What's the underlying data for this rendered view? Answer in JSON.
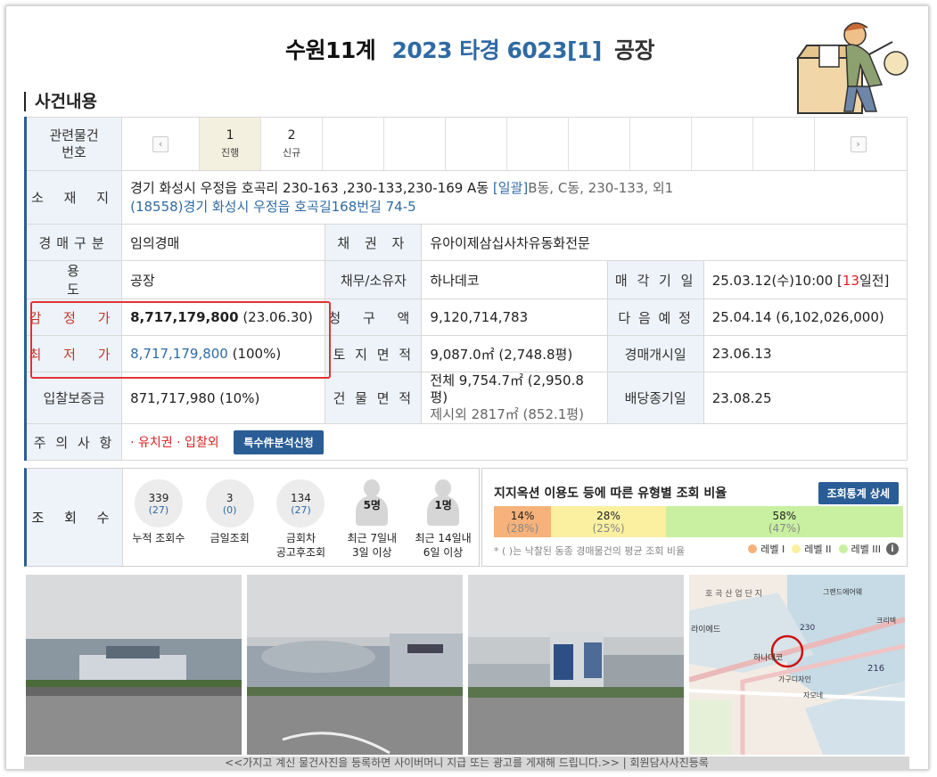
{
  "header": {
    "court": "수원11계",
    "case_no": "2023 타경 6023[1]",
    "kind": "공장"
  },
  "section_title": "사건내용",
  "related": {
    "label": "관련물건\n번호",
    "items": [
      {
        "no": "1",
        "status": "진행"
      },
      {
        "no": "2",
        "status": "신규"
      }
    ],
    "prev": "‹",
    "next": "›"
  },
  "location": {
    "label": "소 재 지",
    "address": "경기 화성시 우정읍 호곡리 230-163 ,230-133,230-169 A동",
    "bundle": "[일괄]",
    "bundle_rest": "B동, C동, 230-133, 외1",
    "road_address": "(18558)경기 화성시  우정읍 호곡길168번길  74-5"
  },
  "rows": {
    "auction_type_label": "경매구분",
    "auction_type": "임의경매",
    "creditor_label": "채 권 자",
    "creditor": "유아이제삼십사차유동화전문",
    "usage_label": "용 도",
    "usage": "공장",
    "debtor_label": "채무/소유자",
    "debtor": "하나데코",
    "sale_date_label": "매 각 기 일",
    "sale_date": "25.03.12(수)10:00 [",
    "sale_days": "13",
    "sale_days_suffix": "일전]",
    "appraisal_label": "감 정 가",
    "appraisal_value": "8,717,179,800",
    "appraisal_date": " (23.06.30)",
    "claim_label": "청 구 액",
    "claim": "9,120,714,783",
    "next_label": "다 음 예 정",
    "next": "25.04.14 (6,102,026,000)",
    "min_label": "최 저 가",
    "min_value": "8,717,179,800",
    "min_pct": " (100%)",
    "land_label": "토 지 면 적",
    "land": "9,087.0㎡ (2,748.8평)",
    "start_label": "경매개시일",
    "start": "23.06.13",
    "deposit_label": "입찰보증금",
    "deposit": "871,717,980 (10%)",
    "building_label": "건 물 면 적",
    "building_total": "전체 9,754.7㎡ (2,950.8평)",
    "building_excl": "제시외 2817㎡ (852.1평)",
    "dividend_label": "배당종기일",
    "dividend": "23.08.25",
    "notice_label": "주 의 사 항",
    "notice": "· 유치권 · 입찰외",
    "special_button": "특수件분석신청"
  },
  "views": {
    "label": "조 회 수",
    "items": [
      {
        "a": "339",
        "b": "(27)",
        "cap1": "누적 조회수",
        "cap2": ""
      },
      {
        "a": "3",
        "b": "(0)",
        "cap1": "금일조회",
        "cap2": ""
      },
      {
        "a": "134",
        "b": "(27)",
        "cap1": "금회차",
        "cap2": "공고후조회"
      }
    ],
    "people": [
      {
        "cnt": "5명",
        "cap1": "최근 7일내",
        "cap2": "3일 이상"
      },
      {
        "cnt": "1명",
        "cap1": "최근 14일내",
        "cap2": "6일 이상"
      }
    ]
  },
  "ratio": {
    "title": "지지옥션 이용도 등에 따른 유형별 조회 비율",
    "button": "조회통계 상세",
    "segments": [
      {
        "p1": "14%",
        "p2": "(28%)",
        "color": "#f6b27a",
        "value": 14
      },
      {
        "p1": "28%",
        "p2": "(25%)",
        "color": "#faf0a0",
        "value": 28
      },
      {
        "p1": "58%",
        "p2": "(47%)",
        "color": "#c8f0a0",
        "value": 58
      }
    ],
    "note": "* ( )는 낙찰된 동종 경매물건의 평균 조회 비율",
    "legend": [
      {
        "label": "레벨 I",
        "color": "#f6b27a"
      },
      {
        "label": "레벨 II",
        "color": "#faf0a0"
      },
      {
        "label": "레벨 III",
        "color": "#c8f0a0"
      }
    ],
    "info_icon": "i"
  },
  "map_labels": {
    "l1": "호 곡 산 업 단 지",
    "l2": "그랜드에어웨",
    "l3": "라이에드",
    "l4": "하나데코",
    "l5": "가구디자인",
    "l6": "230",
    "l7": "216",
    "l8": "크리텍",
    "l9": "자모네"
  },
  "bottom_text": "<<가지고 계신 물건사진을 등록하면 사이버머니 지급 또는 광고를 게재해 드립니다.>>   |  회원담사사진등록"
}
